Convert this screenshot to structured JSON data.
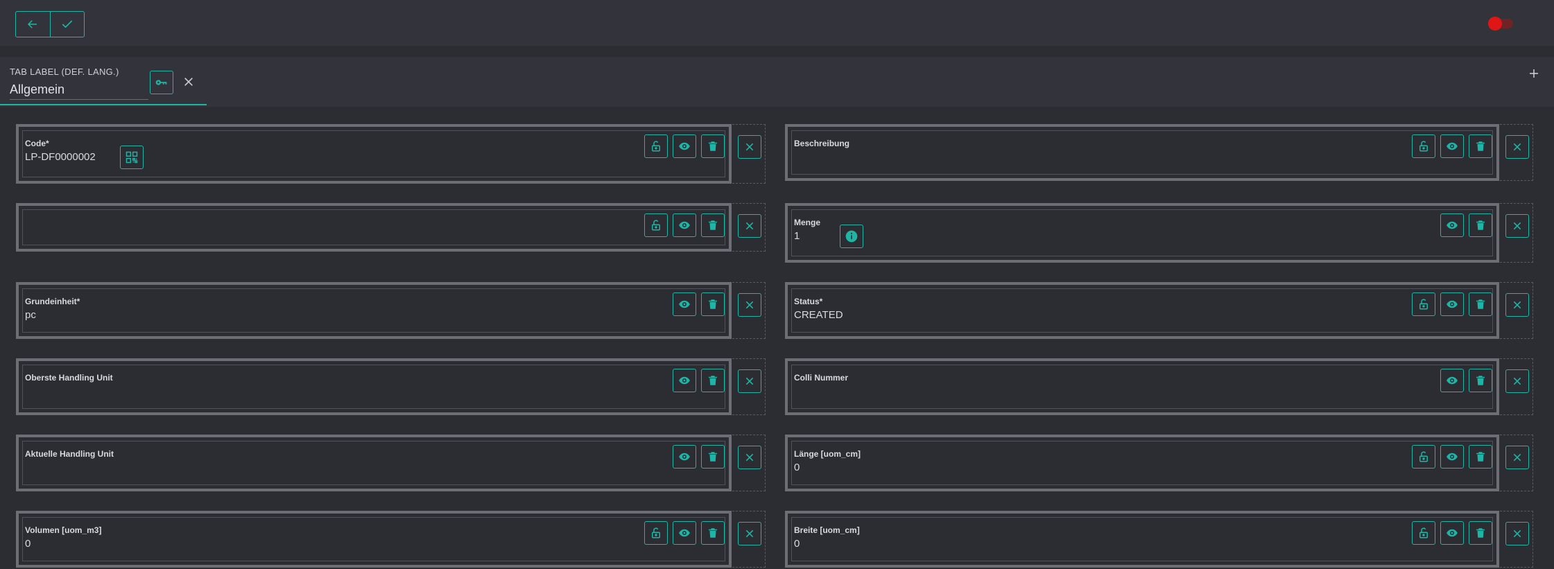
{
  "toolbar": {
    "back_icon": "arrow-left-icon",
    "confirm_icon": "check-icon",
    "toggle_state": "on",
    "toggle_color": "#e01616"
  },
  "tab": {
    "caption": "TAB LABEL (DEF. LANG.)",
    "value": "Allgemein",
    "accent": "#1fb5a6"
  },
  "fields": [
    {
      "label": "Code*",
      "value": "LP-DF0000002",
      "actions": [
        "lock",
        "eye",
        "trash"
      ],
      "extra": "qr"
    },
    {
      "label": "Beschreibung",
      "value": "",
      "actions": [
        "lock",
        "eye",
        "trash"
      ]
    },
    {
      "label": "",
      "value": "",
      "actions": [
        "lock",
        "eye",
        "trash"
      ]
    },
    {
      "label": "Menge",
      "value": "1",
      "actions": [
        "eye",
        "trash"
      ],
      "extra": "info"
    },
    {
      "label": "Grundeinheit*",
      "value": "pc",
      "actions": [
        "eye",
        "trash"
      ]
    },
    {
      "label": "Status*",
      "value": "CREATED",
      "actions": [
        "lock",
        "eye",
        "trash"
      ]
    },
    {
      "label": "Oberste Handling Unit",
      "value": "",
      "actions": [
        "eye",
        "trash"
      ]
    },
    {
      "label": "Colli Nummer",
      "value": "",
      "actions": [
        "eye",
        "trash"
      ]
    },
    {
      "label": "Aktuelle Handling Unit",
      "value": "",
      "actions": [
        "eye",
        "trash"
      ]
    },
    {
      "label": "Länge [uom_cm]",
      "value": "0",
      "actions": [
        "lock",
        "eye",
        "trash"
      ]
    },
    {
      "label": "Volumen [uom_m3]",
      "value": "0",
      "actions": [
        "lock",
        "eye",
        "trash"
      ]
    },
    {
      "label": "Breite [uom_cm]",
      "value": "0",
      "actions": [
        "lock",
        "eye",
        "trash"
      ]
    }
  ]
}
